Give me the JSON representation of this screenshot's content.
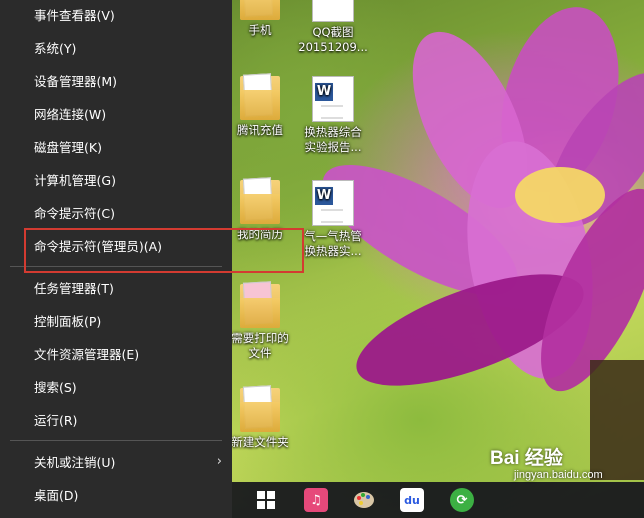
{
  "menu": {
    "items": [
      {
        "label": "事件查看器(V)"
      },
      {
        "label": "系统(Y)"
      },
      {
        "label": "设备管理器(M)"
      },
      {
        "label": "网络连接(W)"
      },
      {
        "label": "磁盘管理(K)"
      },
      {
        "label": "计算机管理(G)"
      },
      {
        "label": "命令提示符(C)"
      },
      {
        "label": "命令提示符(管理员)(A)"
      },
      {
        "label": "任务管理器(T)"
      },
      {
        "label": "控制面板(P)"
      },
      {
        "label": "文件资源管理器(E)"
      },
      {
        "label": "搜索(S)"
      },
      {
        "label": "运行(R)"
      },
      {
        "label": "关机或注销(U)"
      },
      {
        "label": "桌面(D)"
      }
    ],
    "submenu_arrow": "›"
  },
  "desktop_icons": {
    "shouji": "手机",
    "qq_line1": "QQ截图",
    "qq_line2": "20151209...",
    "tengxun": "腾讯充值",
    "huanre_line1": "换热器综合",
    "huanre_line2": "实验报告...",
    "jianli": "我的简历",
    "qiqi_line1": "气—气热管",
    "qiqi_line2": "换热器实...",
    "dayin_line1": "需要打印的",
    "dayin_line2": "文件",
    "xinjian": "新建文件夹"
  },
  "taskbar": {
    "icons": [
      "windows-start-icon",
      "music-app-icon",
      "paint-icon",
      "baidu-icon",
      "refresh-icon"
    ],
    "baidu_text": "du"
  },
  "watermark": {
    "brand": "Bai 经验",
    "url": "jingyan.baidu.com"
  },
  "colors": {
    "menu_bg": "#2b2b2b",
    "highlight_border": "#d33b31",
    "taskbar_bg": "#14141c"
  }
}
